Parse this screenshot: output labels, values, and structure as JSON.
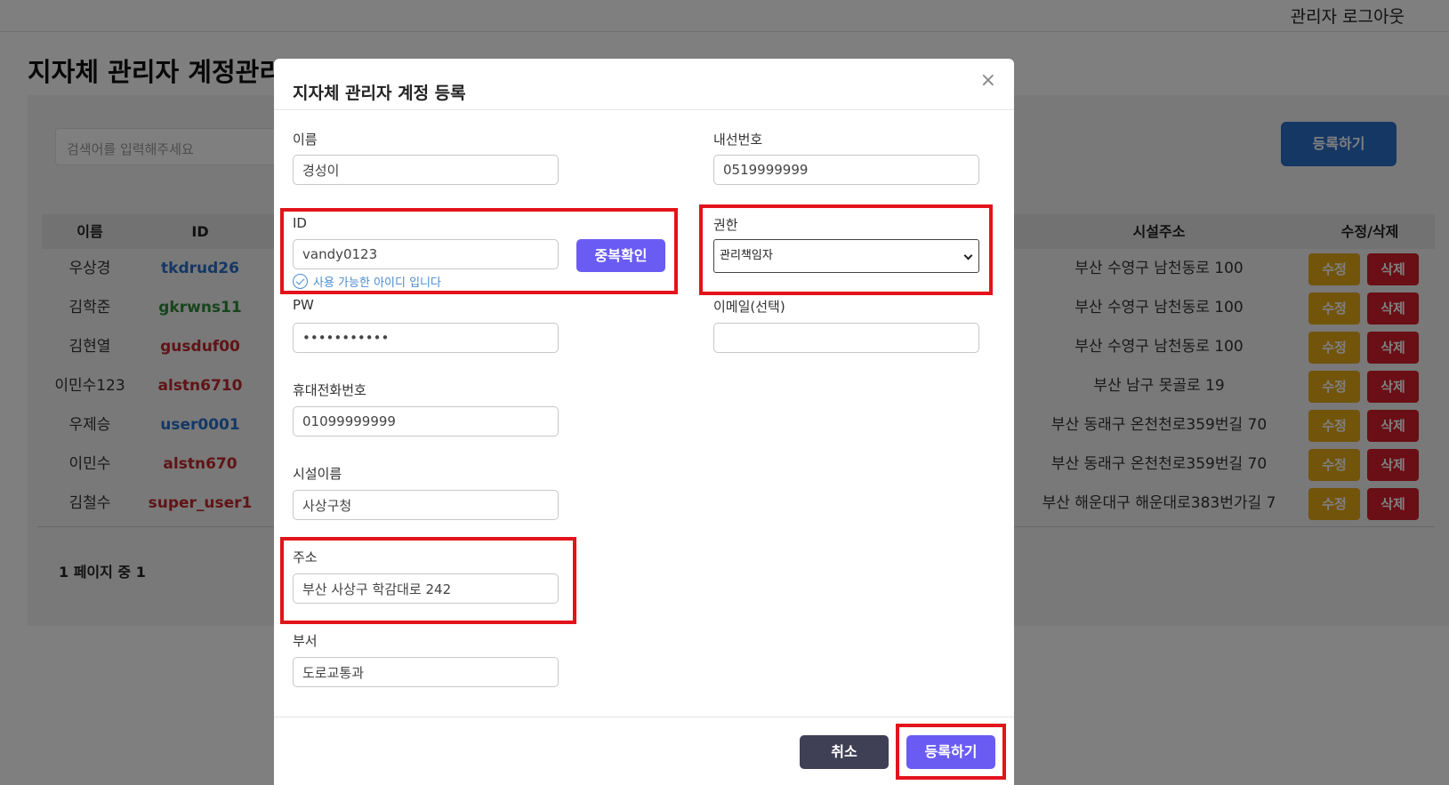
{
  "header": {
    "logout": "관리자 로그아웃"
  },
  "page": {
    "title": "지자체 관리자 계정관리"
  },
  "search": {
    "placeholder": "검색어를 입력해주세요"
  },
  "toolbar": {
    "register_label": "등록하기"
  },
  "table": {
    "columns": {
      "name": "이름",
      "id": "ID",
      "address": "시설주소",
      "actions": "수정/삭제"
    },
    "rows": [
      {
        "name": "우상경",
        "id": "tkdrud26",
        "id_color": "#2a6ec9",
        "address": "부산 수영구 남천동로 100"
      },
      {
        "name": "김학준",
        "id": "gkrwns11",
        "id_color": "#2e8b3a",
        "address": "부산 수영구 남천동로 100"
      },
      {
        "name": "김현열",
        "id": "gusduf00",
        "id_color": "#c0282c",
        "address": "부산 수영구 남천동로 100"
      },
      {
        "name": "이민수123",
        "id": "alstn6710",
        "id_color": "#c0282c",
        "address": "부산 남구 못골로 19"
      },
      {
        "name": "우제승",
        "id": "user0001",
        "id_color": "#2a6ec9",
        "address": "부산 동래구 온천천로359번길 70"
      },
      {
        "name": "이민수",
        "id": "alstn670",
        "id_color": "#c0282c",
        "address": "부산 동래구 온천천로359번길 70"
      },
      {
        "name": "김철수",
        "id": "super_user1",
        "id_color": "#c0282c",
        "address": "부산 해운대구 해운대로383번가길 7"
      }
    ],
    "edit_label": "수정",
    "delete_label": "삭제",
    "pagination": "1 페이지 중 1"
  },
  "modal": {
    "title": "지자체 관리자 계정 등록",
    "close_icon": "×",
    "fields": {
      "name": {
        "label": "이름",
        "value": "경성이"
      },
      "extension": {
        "label": "내선번호",
        "value": "0519999999"
      },
      "id": {
        "label": "ID",
        "value": "vandy0123"
      },
      "dup_check_label": "중복확인",
      "id_hint": "사용 가능한 아이디 입니다",
      "role": {
        "label": "권한",
        "value": "관리책임자"
      },
      "pw": {
        "label": "PW",
        "value": "•••••••••••"
      },
      "email": {
        "label": "이메일(선택)",
        "value": ""
      },
      "mobile": {
        "label": "휴대전화번호",
        "value": "01099999999"
      },
      "facility": {
        "label": "시설이름",
        "value": "사상구청"
      },
      "address": {
        "label": "주소",
        "value": "부산 사상구 학감대로 242"
      },
      "department": {
        "label": "부서",
        "value": "도로교통과"
      }
    },
    "cancel_label": "취소",
    "submit_label": "등록하기"
  },
  "colors": {
    "accent": "#6a5cf3",
    "highlight": "#e3131b",
    "edit": "#e4a817",
    "delete": "#d31f2b",
    "primary": "#2a6ec9"
  }
}
